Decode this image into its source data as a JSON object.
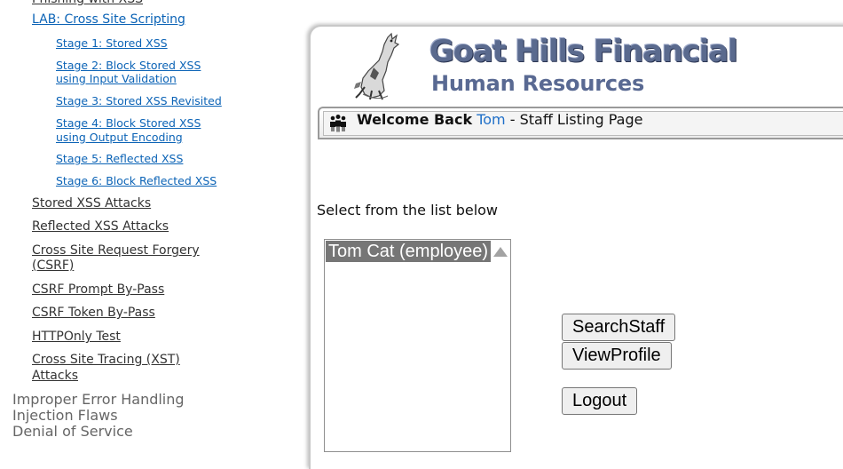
{
  "menu": {
    "top_partial": "Phishing with XSS",
    "lab_title": "LAB: Cross Site Scripting",
    "stages": [
      {
        "line1": "Stage 1: Stored XSS",
        "line2": ""
      },
      {
        "line1": "Stage 2: Block Stored XSS",
        "line2": "using Input Validation"
      },
      {
        "line1": "Stage 3: Stored XSS Revisited",
        "line2": ""
      },
      {
        "line1": "Stage 4: Block Stored XSS",
        "line2": "using Output Encoding"
      },
      {
        "line1": "Stage 5: Reflected XSS",
        "line2": ""
      },
      {
        "line1": "Stage 6: Block Reflected XSS",
        "line2": ""
      }
    ],
    "lessons": [
      {
        "line1": "Stored XSS Attacks",
        "line2": ""
      },
      {
        "line1": "Reflected XSS Attacks",
        "line2": ""
      },
      {
        "line1": "Cross Site Request Forgery",
        "line2": "(CSRF)"
      },
      {
        "line1": "CSRF Prompt By-Pass",
        "line2": ""
      },
      {
        "line1": "CSRF Token By-Pass",
        "line2": ""
      },
      {
        "line1": "HTTPOnly Test",
        "line2": ""
      },
      {
        "line1": "Cross Site Tracing (XST)",
        "line2": "Attacks"
      }
    ],
    "categories": [
      "Improper Error Handling",
      "Injection Flaws",
      "Denial of Service"
    ]
  },
  "app": {
    "logo_title": "Goat Hills Financial",
    "logo_subtitle": "Human Resources",
    "welcome_prefix": "Welcome Back",
    "welcome_user": "Tom",
    "welcome_suffix": " - Staff Listing Page",
    "select_label": "Select from the list below",
    "staff_options": [
      "Tom Cat (employee)"
    ],
    "buttons": {
      "search": "SearchStaff",
      "view": "ViewProfile",
      "logout": "Logout"
    }
  },
  "colors": {
    "link_blue": "#0b63b6",
    "logo_blue": "#5a6a8e",
    "selected_option_bg": "#767676"
  },
  "icons": [
    "goat-logo-icon",
    "people-icon",
    "scroll-up-arrow-icon"
  ]
}
